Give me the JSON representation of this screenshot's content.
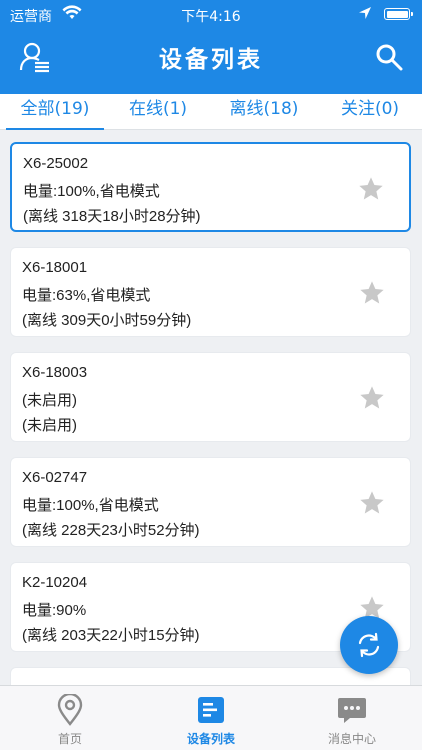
{
  "status_bar": {
    "carrier": "运营商",
    "time": "下午4:16"
  },
  "header": {
    "title": "设备列表"
  },
  "tabs": [
    {
      "label": "全部(19)",
      "active": true
    },
    {
      "label": "在线(1)",
      "active": false
    },
    {
      "label": "离线(18)",
      "active": false
    },
    {
      "label": "关注(0)",
      "active": false
    }
  ],
  "devices": [
    {
      "id": "X6-25002",
      "battery": "电量:100%,省电模式",
      "status": "(离线 318天18小时28分钟)",
      "selected": true
    },
    {
      "id": "X6-18001",
      "battery": "电量:63%,省电模式",
      "status": "(离线 309天0小时59分钟)",
      "selected": false
    },
    {
      "id": "X6-18003",
      "battery": "(未启用)",
      "status": "(未启用)",
      "selected": false
    },
    {
      "id": "X6-02747",
      "battery": "电量:100%,省电模式",
      "status": "(离线 228天23小时52分钟)",
      "selected": false
    },
    {
      "id": "K2-10204",
      "battery": "电量:90%",
      "status": "(离线 203天22小时15分钟)",
      "selected": false
    },
    {
      "id": "",
      "battery": "",
      "status": "",
      "selected": false
    }
  ],
  "bottom_nav": [
    {
      "label": "首页",
      "icon": "location-pin-icon",
      "active": false
    },
    {
      "label": "设备列表",
      "icon": "device-list-icon",
      "active": true
    },
    {
      "label": "消息中心",
      "icon": "message-icon",
      "active": false
    }
  ],
  "colors": {
    "primary": "#1e88e5",
    "background": "#eef0f3",
    "star": "#c8c8c8",
    "inactive_text": "#888888"
  },
  "icons": {
    "user": "user-list-icon",
    "search": "search-icon",
    "star": "star-icon",
    "refresh": "refresh-icon"
  }
}
